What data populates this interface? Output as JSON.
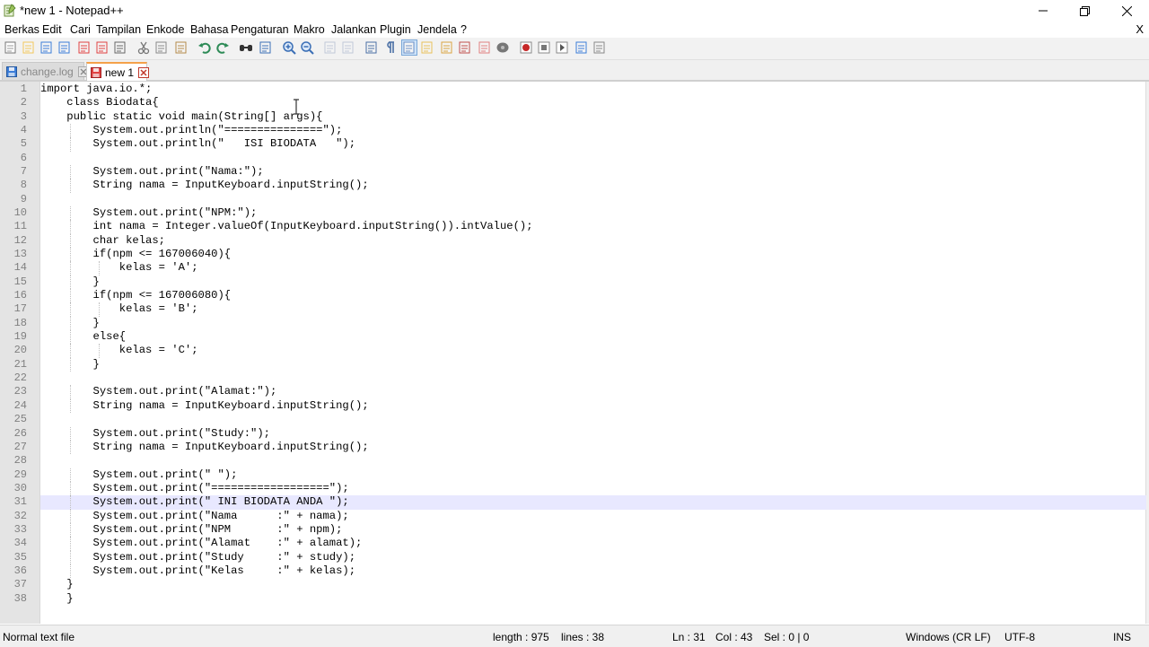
{
  "window": {
    "title": "*new 1 - Notepad++"
  },
  "menu": {
    "items": [
      "Berkas",
      "Edit",
      "Cari",
      "Tampilan",
      "Enkode",
      "Bahasa",
      "Pengaturan",
      "Makro",
      "Jalankan",
      "Plugin",
      "Jendela",
      "?"
    ],
    "close_label": "X"
  },
  "toolbar": {
    "icons": [
      "new-file-icon",
      "open-file-icon",
      "save-icon",
      "save-all-icon",
      "close-file-icon",
      "close-all-icon",
      "print-icon",
      "cut-icon",
      "copy-icon",
      "paste-icon",
      "undo-icon",
      "redo-icon",
      "find-icon",
      "replace-icon",
      "zoom-in-icon",
      "zoom-out-icon",
      "sync-vertical-icon",
      "sync-horizontal-icon",
      "word-wrap-icon",
      "show-all-chars-icon",
      "indent-guide-icon",
      "user-language-icon",
      "document-map-icon",
      "function-list-icon",
      "folder-workspace-icon",
      "monitoring-icon",
      "record-macro-icon",
      "stop-record-icon",
      "play-macro-icon",
      "run-macro-multiple-icon",
      "save-macro-icon"
    ]
  },
  "tabs": [
    {
      "label": "change.log",
      "active": false
    },
    {
      "label": "new 1",
      "active": true
    }
  ],
  "editor": {
    "current_line": 31,
    "lines": [
      "import java.io.*;",
      "    class Biodata{",
      "    public static void main(String[] args){",
      "        System.out.println(\"===============\");",
      "        System.out.println(\"   ISI BIODATA   \");",
      "",
      "        System.out.print(\"Nama:\");",
      "        String nama = InputKeyboard.inputString();",
      "",
      "        System.out.print(\"NPM:\");",
      "        int nama = Integer.valueOf(InputKeyboard.inputString()).intValue();",
      "        char kelas;",
      "        if(npm <= 167006040){",
      "            kelas = 'A';",
      "        }",
      "        if(npm <= 167006080){",
      "            kelas = 'B';",
      "        }",
      "        else{",
      "            kelas = 'C';",
      "        }",
      "",
      "        System.out.print(\"Alamat:\");",
      "        String nama = InputKeyboard.inputString();",
      "",
      "        System.out.print(\"Study:\");",
      "        String nama = InputKeyboard.inputString();",
      "",
      "        System.out.print(\" \");",
      "        System.out.print(\"==================\");",
      "        System.out.print(\" INI BIODATA ANDA \");",
      "        System.out.print(\"Nama      :\" + nama);",
      "        System.out.print(\"NPM       :\" + npm);",
      "        System.out.print(\"Alamat    :\" + alamat);",
      "        System.out.print(\"Study     :\" + study);",
      "        System.out.print(\"Kelas     :\" + kelas);",
      "    }",
      "    }"
    ]
  },
  "status": {
    "file_type": "Normal text file",
    "length": "length : 975",
    "lines": "lines : 38",
    "ln": "Ln : 31",
    "col": "Col : 43",
    "sel": "Sel : 0 | 0",
    "eol": "Windows (CR LF)",
    "encoding": "UTF-8",
    "mode": "INS"
  },
  "colors": {
    "current_line_bg": "#e8e8ff",
    "active_tab_accent": "#f4a14a",
    "gutter_bg": "#e4e4e4",
    "line_number": "#808080"
  }
}
